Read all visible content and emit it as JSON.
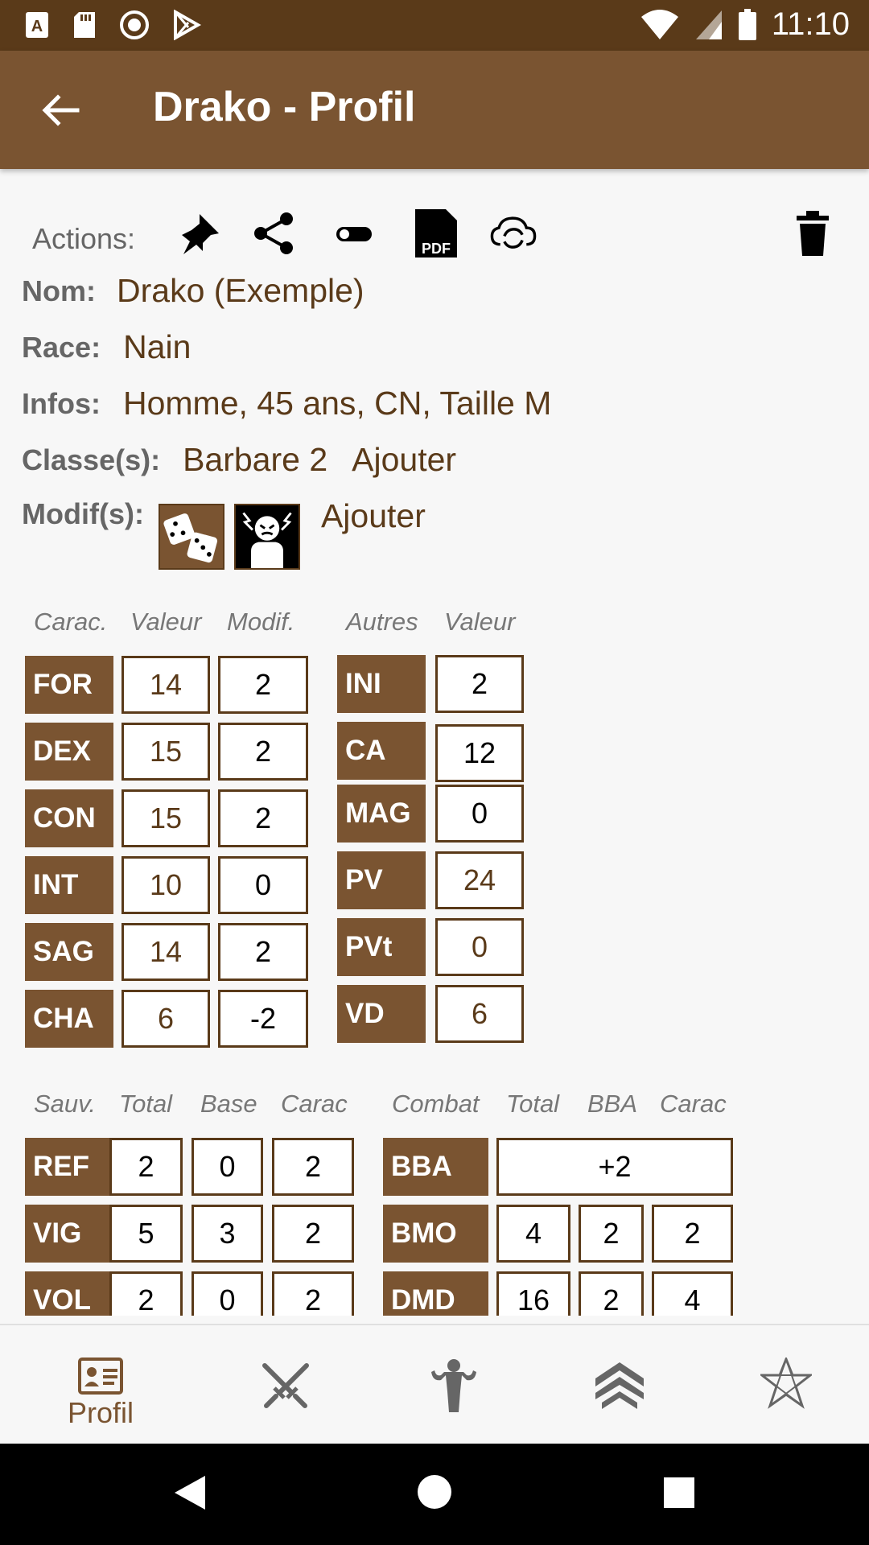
{
  "status_bar": {
    "time": "11:10"
  },
  "app_bar": {
    "title": "Drako - Profil"
  },
  "actions": {
    "label": "Actions:"
  },
  "info": {
    "nom_label": "Nom:",
    "nom_value": "Drako (Exemple)",
    "race_label": "Race:",
    "race_value": "Nain",
    "infos_label": "Infos:",
    "infos_value": "Homme, 45 ans, CN, Taille M",
    "classes_label": "Classe(s):",
    "classes_value": "Barbare 2",
    "classes_add": "Ajouter",
    "modifs_label": "Modif(s):",
    "modifs_add": "Ajouter"
  },
  "carac_table": {
    "headers": [
      "Carac.",
      "Valeur",
      "Modif."
    ],
    "rows": [
      {
        "label": "FOR",
        "value": "14",
        "modif": "2"
      },
      {
        "label": "DEX",
        "value": "15",
        "modif": "2"
      },
      {
        "label": "CON",
        "value": "15",
        "modif": "2"
      },
      {
        "label": "INT",
        "value": "10",
        "modif": "0"
      },
      {
        "label": "SAG",
        "value": "14",
        "modif": "2"
      },
      {
        "label": "CHA",
        "value": "6",
        "modif": "-2"
      }
    ]
  },
  "autres_table": {
    "headers": [
      "Autres",
      "Valeur"
    ],
    "rows": [
      {
        "label": "INI",
        "value": "2"
      },
      {
        "label": "CA",
        "value": "12"
      },
      {
        "label": "MAG",
        "value": "0"
      },
      {
        "label": "PV",
        "value": "24"
      },
      {
        "label": "PVt",
        "value": "0"
      },
      {
        "label": "VD",
        "value": "6"
      }
    ]
  },
  "sauv_table": {
    "headers": [
      "Sauv.",
      "Total",
      "Base",
      "Carac"
    ],
    "rows": [
      {
        "label": "REF",
        "total": "2",
        "base": "0",
        "carac": "2"
      },
      {
        "label": "VIG",
        "total": "5",
        "base": "3",
        "carac": "2"
      },
      {
        "label": "VOL",
        "total": "2",
        "base": "0",
        "carac": "2"
      }
    ]
  },
  "combat_table": {
    "headers": [
      "Combat",
      "Total",
      "BBA",
      "Carac"
    ],
    "bba_row": {
      "label": "BBA",
      "value": "+2"
    },
    "rows": [
      {
        "label": "BMO",
        "total": "4",
        "bba": "2",
        "carac": "2"
      },
      {
        "label": "DMD",
        "total": "16",
        "bba": "2",
        "carac": "4"
      }
    ]
  },
  "bottom_nav": {
    "profil_label": "Profil"
  },
  "colors": {
    "brown": "#7a5431",
    "dark_brown": "#5a3a19",
    "status_bar": "#5a3a19"
  }
}
